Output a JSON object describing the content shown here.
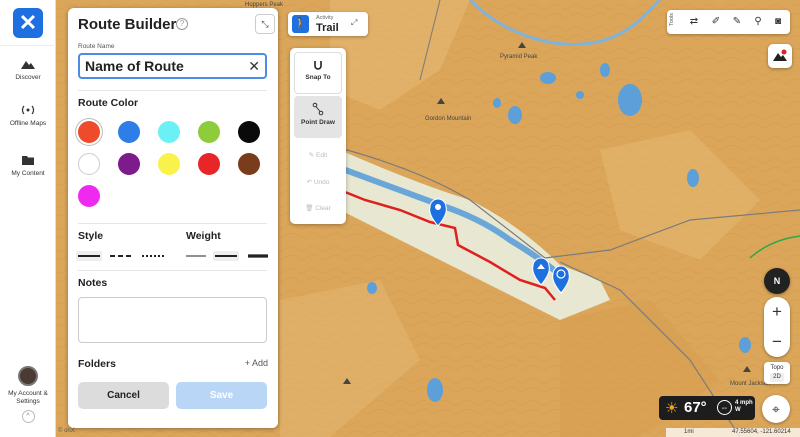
{
  "nav": {
    "items": [
      {
        "label": "Discover"
      },
      {
        "label": "Offline Maps"
      },
      {
        "label": "My Content"
      },
      {
        "label": "My Account & Settings"
      }
    ]
  },
  "panel": {
    "title": "Route Builder",
    "help_glyph": "?",
    "route_name_label": "Route Name",
    "route_name_value": "Name of Route",
    "clear_glyph": "✕",
    "route_color_label": "Route Color",
    "colors": [
      "#ef4a2a",
      "#2f7ee8",
      "#6bf1f5",
      "#8fcc3c",
      "#0a0a0a",
      "#ffffff",
      "#7d1a8c",
      "#f9f24a",
      "#e8262a",
      "#7a3d1c",
      "#ee2af0"
    ],
    "selected_color": "#ef4a2a",
    "style_label": "Style",
    "weight_label": "Weight",
    "notes_label": "Notes",
    "folders_label": "Folders",
    "add_label": "+ Add",
    "cancel_label": "Cancel",
    "save_label": "Save"
  },
  "activity": {
    "caption": "Activity",
    "value": "Trail"
  },
  "tools_panel": {
    "snap_to": "Snap To",
    "point_draw": "Point Draw",
    "edit": "Edit",
    "undo": "Undo",
    "clear": "Clear"
  },
  "right_tools": {
    "label": "Tools"
  },
  "map": {
    "peaks": [
      "Hoppers Peak",
      "Gordon Mountain",
      "Pyramid Peak",
      "Mount Jackson"
    ],
    "layer": {
      "name": "Topo",
      "mode": "2D"
    },
    "compass": "N",
    "zoom_in": "+",
    "zoom_out": "−"
  },
  "weather": {
    "temp": "67°",
    "wind_speed": "4",
    "wind_unit": "mph",
    "wind_dir": "W"
  },
  "scale": {
    "distance": "1mi",
    "coords": "47.55604, -121.60214"
  },
  "attribution": "© onX"
}
